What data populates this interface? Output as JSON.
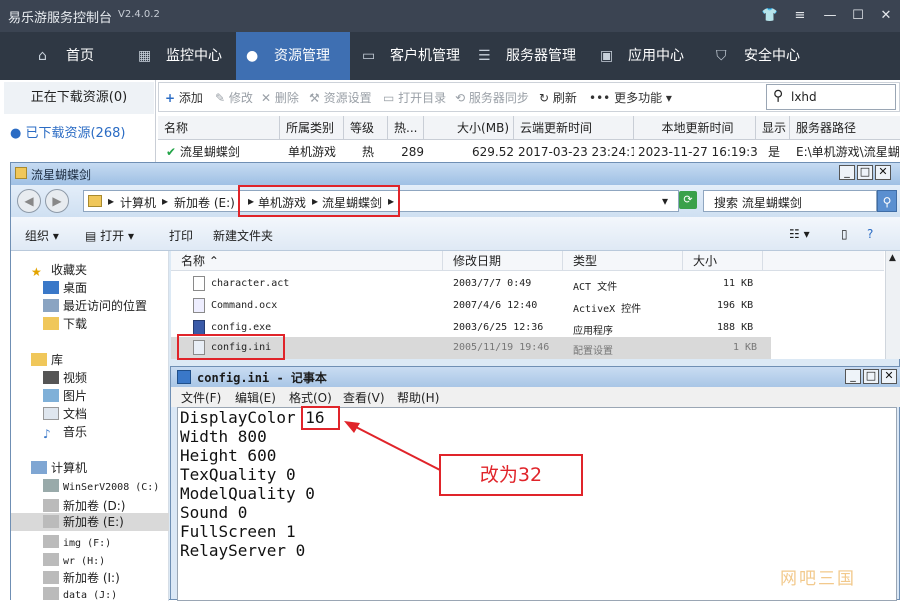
{
  "app": {
    "title": "易乐游服务控制台",
    "version": "V2.4.0.2"
  },
  "nav": [
    "首页",
    "监控中心",
    "资源管理",
    "客户机管理",
    "服务器管理",
    "应用中心",
    "安全中心"
  ],
  "left_panel": {
    "downloading": "正在下载资源(0)",
    "downloaded": "已下载资源(268)"
  },
  "toolbar": {
    "add": "添加",
    "edit": "修改",
    "delete": "删除",
    "res_settings": "资源设置",
    "open_dir": "打开目录",
    "sync": "服务器同步",
    "refresh": "刷新",
    "more": "更多功能"
  },
  "search": {
    "value": "lxhd"
  },
  "table": {
    "headers": [
      "名称",
      "所属类别",
      "等级",
      "热...",
      "大小(MB)",
      "云端更新时间",
      "本地更新时间",
      "显示",
      "服务器路径"
    ],
    "row": [
      "流星蝴蝶剑",
      "单机游戏",
      "热",
      "289",
      "629.52",
      "2017-03-23 23:24:10",
      "2023-11-27 16:19:31",
      "是",
      "E:\\单机游戏\\流星蝴"
    ]
  },
  "explorer": {
    "title": "流星蝴蝶剑",
    "crumbs": [
      "计算机",
      "新加卷 (E:)",
      "单机游戏",
      "流星蝴蝶剑"
    ],
    "search_placeholder": "搜索 流星蝴蝶剑",
    "commands": [
      "组织",
      "打开",
      "打印",
      "新建文件夹"
    ],
    "nav_items": [
      "收藏夹",
      "桌面",
      "最近访问的位置",
      "下载",
      "库",
      "视频",
      "图片",
      "文档",
      "音乐",
      "计算机",
      "WinSerV2008 (C:)",
      "新加卷 (D:)",
      "新加卷 (E:)",
      "img (F:)",
      "wr (H:)",
      "新加卷 (I:)",
      "data (J:)"
    ],
    "file_headers": [
      "名称",
      "修改日期",
      "类型",
      "大小"
    ],
    "files": [
      {
        "name": "character.act",
        "date": "2003/7/7 0:49",
        "type": "ACT 文件",
        "size": "11 KB"
      },
      {
        "name": "Command.ocx",
        "date": "2007/4/6 12:40",
        "type": "ActiveX 控件",
        "size": "196 KB"
      },
      {
        "name": "config.exe",
        "date": "2003/6/25 12:36",
        "type": "应用程序",
        "size": "188 KB"
      },
      {
        "name": "config.ini",
        "date": "2005/11/19 19:46",
        "type": "配置设置",
        "size": "1 KB"
      }
    ]
  },
  "notepad": {
    "title": "config.ini - 记事本",
    "menu": [
      "文件(F)",
      "编辑(E)",
      "格式(O)",
      "查看(V)",
      "帮助(H)"
    ],
    "lines": [
      "DisplayColor 16",
      "Width 800",
      "Height 600",
      "TexQuality 0",
      "ModelQuality 0",
      "Sound 0",
      "FullScreen 1",
      "RelayServer 0"
    ]
  },
  "annotation": {
    "callout": "改为32",
    "color": "#e0242a"
  },
  "watermark": "网吧三国",
  "colors": {
    "nav_bg": "#2f3844",
    "nav_active": "#3e6fb2",
    "title_bg": "#3b4452"
  }
}
